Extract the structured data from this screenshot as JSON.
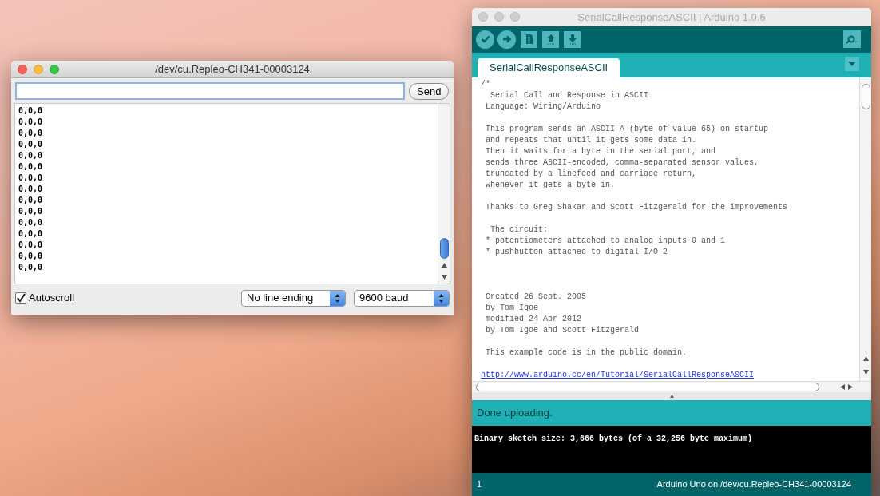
{
  "serial_monitor": {
    "title": "/dev/cu.Repleo-CH341-00003124",
    "send_button": "Send",
    "output_lines": [
      "0,0,0",
      "0,0,0",
      "0,0,0",
      "0,0,0",
      "0,0,0",
      "0,0,0",
      "0,0,0",
      "0,0,0",
      "0,0,0",
      "0,0,0",
      "0,0,0",
      "0,0,0",
      "0,0,0",
      "0,0,0",
      "0,0,0"
    ],
    "autoscroll": {
      "label": "Autoscroll",
      "checked": true
    },
    "line_ending": "No line ending",
    "baud": "9600 baud"
  },
  "ide": {
    "title": "SerialCallResponseASCII | Arduino 1.0.6",
    "toolbar": [
      {
        "kind": "verify"
      },
      {
        "kind": "upload"
      },
      {
        "kind": "new"
      },
      {
        "kind": "open"
      },
      {
        "kind": "save"
      }
    ],
    "tabs": [
      {
        "label": "SerialCallResponseASCII",
        "selected": true
      }
    ],
    "code": "/*\n  Serial Call and Response in ASCII\n Language: Wiring/Arduino\n\n This program sends an ASCII A (byte of value 65) on startup\n and repeats that until it gets some data in.\n Then it waits for a byte in the serial port, and\n sends three ASCII-encoded, comma-separated sensor values,\n truncated by a linefeed and carriage return,\n whenever it gets a byte in.\n\n Thanks to Greg Shakar and Scott Fitzgerald for the improvements\n\n  The circuit:\n * potentiometers attached to analog inputs 0 and 1\n * pushbutton attached to digital I/O 2\n\n\n\n Created 26 Sept. 2005\n by Tom Igoe\n modified 24 Apr 2012\n by Tom Igoe and Scott Fitzgerald\n\n This example code is in the public domain.",
    "code_link": "http://www.arduino.cc/en/Tutorial/SerialCallResponseASCII",
    "status": "Done uploading.",
    "console": "Binary sketch size: 3,666 bytes (of a 32,256 byte maximum)",
    "line_number": "1",
    "board": "Arduino Uno on /dev/cu.Repleo-CH341-00003124"
  }
}
